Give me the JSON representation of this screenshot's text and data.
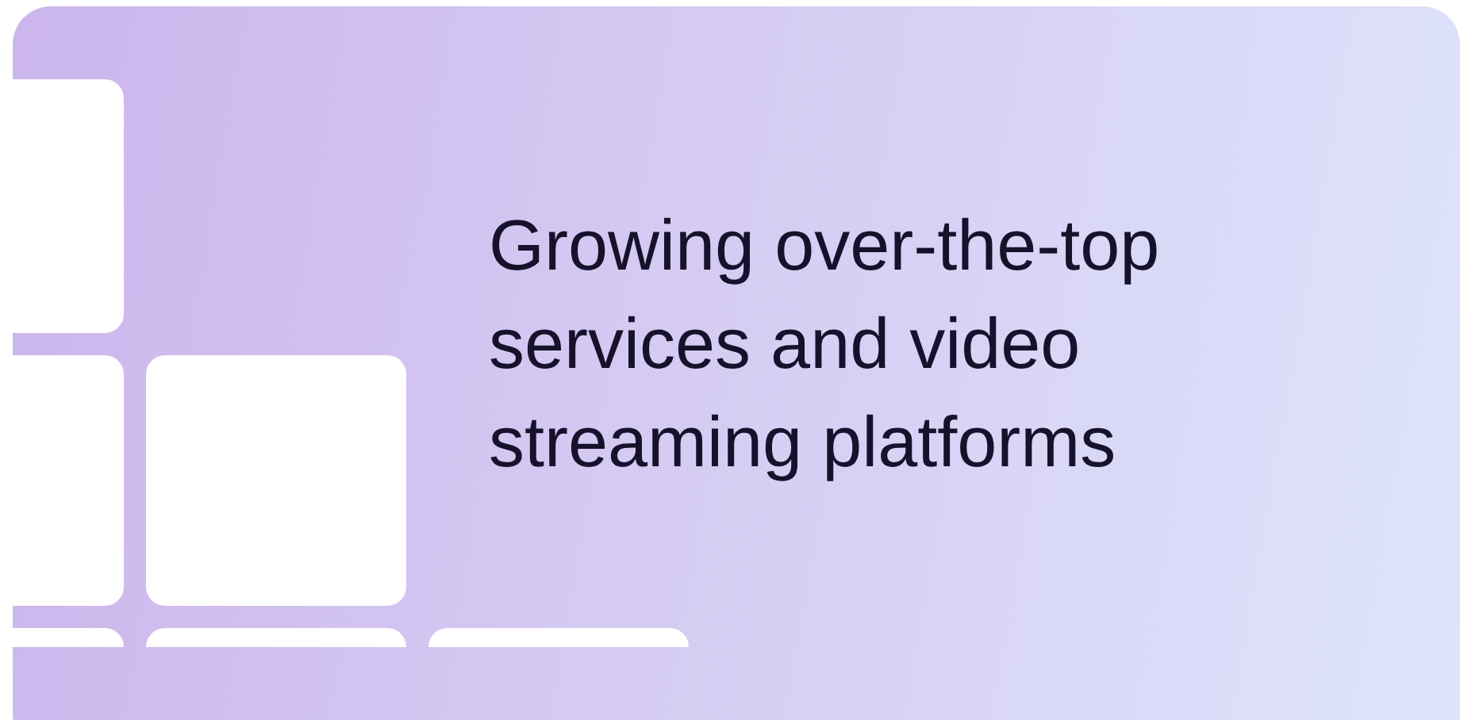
{
  "card": {
    "heading": "Growing over-the-top services and video streaming platforms"
  }
}
